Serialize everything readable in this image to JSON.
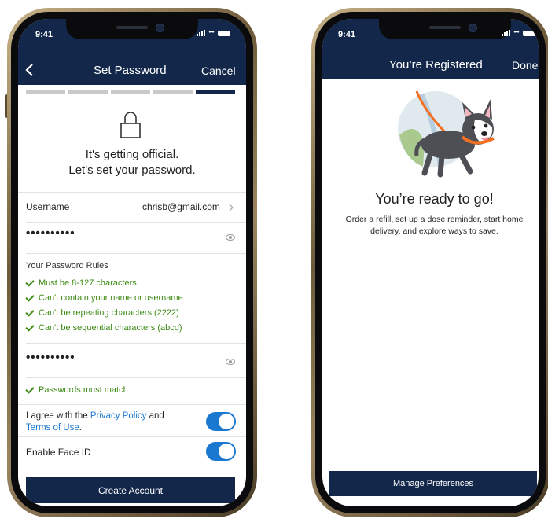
{
  "left_phone": {
    "status_time": "9:41",
    "nav": {
      "back_icon": "chevron-left-icon",
      "title": "Set Password",
      "cancel_label": "Cancel"
    },
    "progress": {
      "total_steps": 5,
      "current_step": 5
    },
    "lock_icon": "lock-icon",
    "heading_line1": "It's getting official.",
    "heading_line2": "Let's set your password.",
    "username": {
      "label": "Username",
      "value": "chrisb@gmail.com"
    },
    "password_dots": "••••••••••",
    "rules_title": "Your Password Rules",
    "rules": [
      "Must be 8-127 characters",
      "Can't contain your name or username",
      "Can't be repeating characters (2222)",
      "Can't be sequential characters (abcd)"
    ],
    "confirm_dots": "••••••••••",
    "match_rule": "Passwords must match",
    "agree": {
      "prefix": "I agree with the ",
      "privacy_link": "Privacy Policy",
      "middle": " and",
      "terms_link": "Terms of Use",
      "suffix": "."
    },
    "face_id_label": "Enable Face ID",
    "cta_label": "Create Account",
    "colors": {
      "navy": "#13274a",
      "green": "#3b8a12",
      "blue": "#1b78d0"
    }
  },
  "right_phone": {
    "status_time": "9:41",
    "nav": {
      "title": "You’re Registered",
      "done_label": "Done"
    },
    "illustration": "dog-walking-illustration",
    "heading": "You’re ready to go!",
    "body_line1": "Order a refill, set up a dose reminder, start home",
    "body_line2": "delivery, and explore ways to save.",
    "cta_label": "Manage Preferences"
  }
}
